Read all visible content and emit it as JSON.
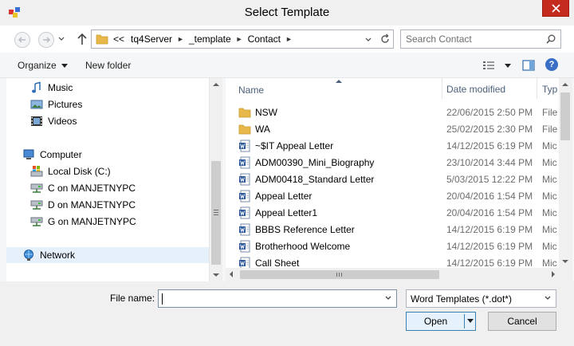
{
  "window": {
    "title": "Select Template"
  },
  "address": {
    "overflow": "<<",
    "crumbs": [
      "tq4Server",
      "_template",
      "Contact"
    ],
    "search_placeholder": "Search Contact"
  },
  "toolbar": {
    "organize_label": "Organize",
    "new_folder_label": "New folder"
  },
  "nav": {
    "music": "Music",
    "pictures": "Pictures",
    "videos": "Videos",
    "computer": "Computer",
    "local_disk": "Local Disk (C:)",
    "c_drive": "C on MANJETNYPC",
    "d_drive": "D on MANJETNYPC",
    "g_drive": "G on MANJETNYPC",
    "network": "Network"
  },
  "columns": {
    "name": "Name",
    "date": "Date modified",
    "type": "Typ"
  },
  "files": [
    {
      "name": "NSW",
      "date": "22/06/2015 2:50 PM",
      "type": "File",
      "icon": "folder-icon"
    },
    {
      "name": "WA",
      "date": "25/02/2015 2:30 PM",
      "type": "File",
      "icon": "folder-icon"
    },
    {
      "name": "~$IT Appeal Letter",
      "date": "14/12/2015 6:19 PM",
      "type": "Mic",
      "icon": "word-doc-icon"
    },
    {
      "name": "ADM00390_Mini_Biography",
      "date": "23/10/2014 3:44 PM",
      "type": "Mic",
      "icon": "word-doc-icon"
    },
    {
      "name": "ADM00418_Standard Letter",
      "date": "5/03/2015 12:22 PM",
      "type": "Mic",
      "icon": "word-doc-icon"
    },
    {
      "name": "Appeal Letter",
      "date": "20/04/2016 1:54 PM",
      "type": "Mic",
      "icon": "word-doc-icon"
    },
    {
      "name": "Appeal Letter1",
      "date": "20/04/2016 1:54 PM",
      "type": "Mic",
      "icon": "word-doc-icon"
    },
    {
      "name": "BBBS Reference Letter",
      "date": "14/12/2015 6:19 PM",
      "type": "Mic",
      "icon": "word-doc-icon"
    },
    {
      "name": "Brotherhood Welcome",
      "date": "14/12/2015 6:19 PM",
      "type": "Mic",
      "icon": "word-doc-icon"
    },
    {
      "name": "Call Sheet",
      "date": "14/12/2015 6:19 PM",
      "type": "Mic",
      "icon": "word-doc-icon"
    }
  ],
  "bottom": {
    "file_name_label": "File name:",
    "file_name_value": "",
    "filter_value": "Word Templates (*.dot*)",
    "open_label": "Open",
    "cancel_label": "Cancel"
  },
  "colors": {
    "close": "#c42b1c",
    "folder": "#e8b84a",
    "word": "#2b579a",
    "selected": "#e5f0fb"
  }
}
